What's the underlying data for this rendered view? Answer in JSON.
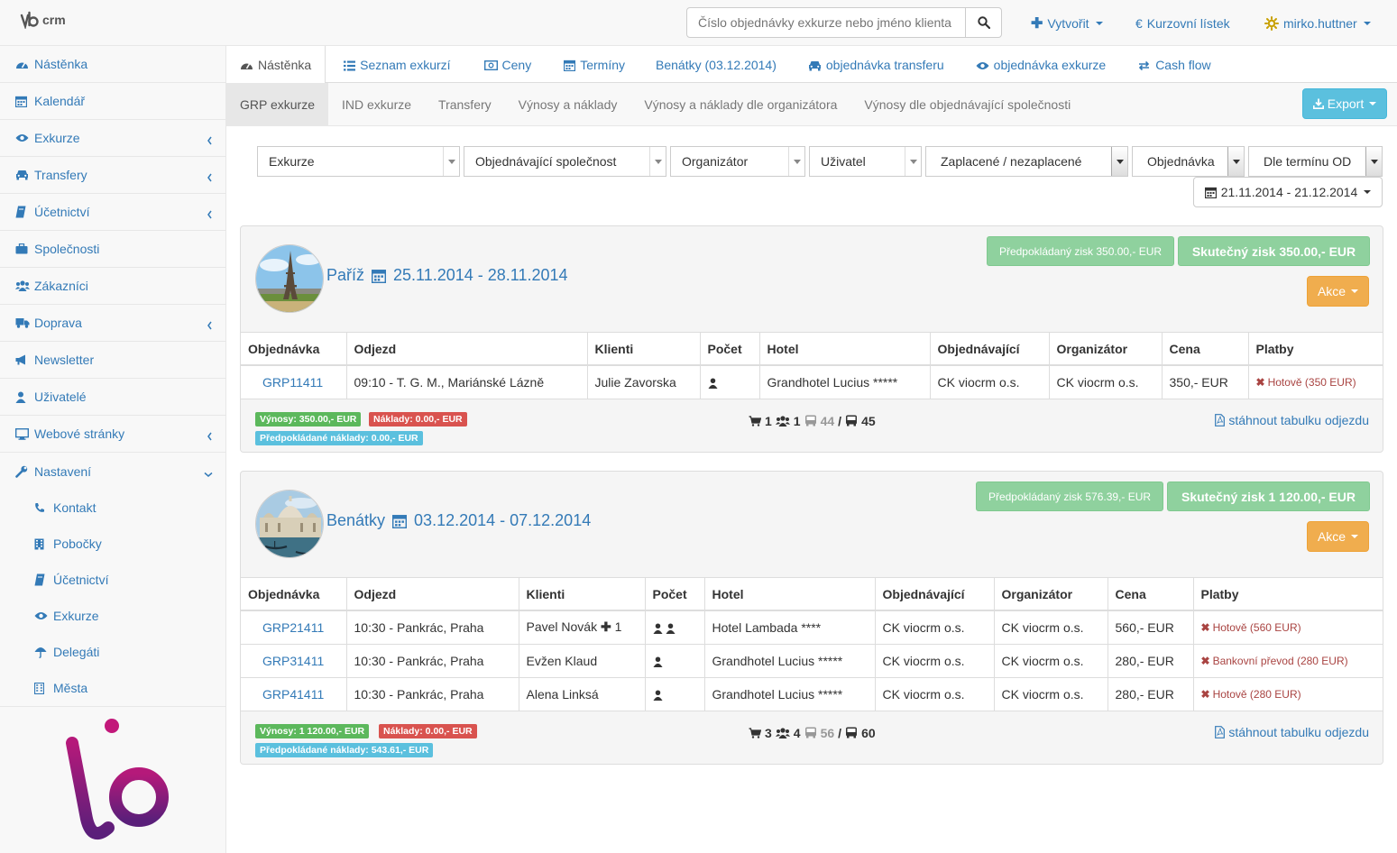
{
  "brand": {
    "name": "crm"
  },
  "search": {
    "placeholder": "Číslo objednávky exkurze nebo jméno klienta"
  },
  "topnav": {
    "create": "Vytvořit",
    "exchange": "Kurzovní lístek",
    "user": "mirko.huttner"
  },
  "sidebar": {
    "items": [
      {
        "label": "Nástěnka",
        "icon": "dashboard-icon"
      },
      {
        "label": "Kalendář",
        "icon": "calendar-icon"
      },
      {
        "label": "Exkurze",
        "icon": "eye-icon",
        "submenu": true
      },
      {
        "label": "Transfery",
        "icon": "car-icon",
        "submenu": true
      },
      {
        "label": "Účetnictví",
        "icon": "book-icon",
        "submenu": true
      },
      {
        "label": "Společnosti",
        "icon": "briefcase-icon"
      },
      {
        "label": "Zákazníci",
        "icon": "users-icon"
      },
      {
        "label": "Doprava",
        "icon": "truck-icon",
        "submenu": true
      },
      {
        "label": "Newsletter",
        "icon": "bullhorn-icon"
      },
      {
        "label": "Uživatelé",
        "icon": "user-icon"
      },
      {
        "label": "Webové stránky",
        "icon": "desktop-icon",
        "submenu": true
      },
      {
        "label": "Nastavení",
        "icon": "wrench-icon",
        "expanded": true
      }
    ],
    "subitems": [
      {
        "label": "Kontakt",
        "icon": "phone-icon"
      },
      {
        "label": "Pobočky",
        "icon": "building-icon"
      },
      {
        "label": "Účetnictví",
        "icon": "book-icon"
      },
      {
        "label": "Exkurze",
        "icon": "eye-icon"
      },
      {
        "label": "Delegáti",
        "icon": "umbrella-icon"
      },
      {
        "label": "Města",
        "icon": "building-icon"
      }
    ]
  },
  "tabs": [
    {
      "label": "Nástěnka",
      "icon": "dashboard-icon"
    },
    {
      "label": "Seznam exkurzí",
      "icon": "list-icon"
    },
    {
      "label": "Ceny",
      "icon": "money-icon"
    },
    {
      "label": "Termíny",
      "icon": "calendar-icon"
    },
    {
      "label": "Benátky (03.12.2014)",
      "icon": ""
    },
    {
      "label": "objednávka transferu",
      "icon": "car-icon"
    },
    {
      "label": "objednávka exkurze",
      "icon": "eye-icon"
    },
    {
      "label": "Cash flow",
      "icon": "exchange-icon"
    }
  ],
  "subtabs": [
    "GRP exkurze",
    "IND exkurze",
    "Transfery",
    "Výnosy a náklady",
    "Výnosy a náklady dle organizátora",
    "Výnosy dle objednávající společnosti"
  ],
  "export": {
    "label": "Export"
  },
  "filters": [
    "Exkurze",
    "Objednávající společnost",
    "Organizátor",
    "Uživatel",
    "Zaplacené / nezaplacené",
    "Objednávka",
    "Dle termínu OD"
  ],
  "daterange": "21.11.2014 - 21.12.2014",
  "headers": [
    "Objednávka",
    "Odjezd",
    "Klienti",
    "Počet",
    "Hotel",
    "Objednávající",
    "Organizátor",
    "Cena",
    "Platby"
  ],
  "akce": "Akce",
  "download": "stáhnout tabulku odjezdu",
  "trips": [
    {
      "city": "Paříž",
      "dates": "25.11.2014 - 28.11.2014",
      "pred_zisk": "Předpokládaný zisk 350.00,- EUR",
      "skut_zisk": "Skutečný zisk 350.00,- EUR",
      "rows": [
        {
          "order": "GRP11411",
          "departure": "09:10 - T. G. M., Mariánské Lázně",
          "client": "Julie Zavorska",
          "extra": "",
          "count": 1,
          "hotel": "Grandhotel Lucius *****",
          "company": "CK viocrm o.s.",
          "organizer": "CK viocrm o.s.",
          "price": "350,- EUR",
          "payment": "Hotově (350 EUR)"
        }
      ],
      "vynosy": "Výnosy: 350.00,- EUR",
      "naklady": "Náklady: 0.00,- EUR",
      "pred_naklady": "Předpokládané náklady: 0.00,- EUR",
      "stats": {
        "orders": "1",
        "persons": "1",
        "capacity": "44",
        "seats": "45"
      }
    },
    {
      "city": "Benátky",
      "dates": "03.12.2014 - 07.12.2014",
      "pred_zisk": "Předpokládaný zisk 576.39,- EUR",
      "skut_zisk": "Skutečný zisk 1 120.00,- EUR",
      "rows": [
        {
          "order": "GRP21411",
          "departure": "10:30 - Pankrác, Praha",
          "client": "Pavel Novák",
          "extra": "1",
          "count": 2,
          "hotel": "Hotel Lambada ****",
          "company": "CK viocrm o.s.",
          "organizer": "CK viocrm o.s.",
          "price": "560,- EUR",
          "payment": "Hotově (560 EUR)"
        },
        {
          "order": "GRP31411",
          "departure": "10:30 - Pankrác, Praha",
          "client": "Evžen Klaud",
          "extra": "",
          "count": 1,
          "hotel": "Grandhotel Lucius *****",
          "company": "CK viocrm o.s.",
          "organizer": "CK viocrm o.s.",
          "price": "280,- EUR",
          "payment": "Bankovní převod (280 EUR)"
        },
        {
          "order": "GRP41411",
          "departure": "10:30 - Pankrác, Praha",
          "client": "Alena Linksá",
          "extra": "",
          "count": 1,
          "hotel": "Grandhotel Lucius *****",
          "company": "CK viocrm o.s.",
          "organizer": "CK viocrm o.s.",
          "price": "280,- EUR",
          "payment": "Hotově (280 EUR)"
        }
      ],
      "vynosy": "Výnosy: 1 120.00,- EUR",
      "naklady": "Náklady: 0.00,- EUR",
      "pred_naklady": "Předpokládané náklady: 543.61,- EUR",
      "stats": {
        "orders": "3",
        "persons": "4",
        "capacity": "56",
        "seats": "60"
      }
    }
  ],
  "colors": {
    "link": "#337ab7",
    "success": "#5cb85c",
    "danger": "#d9534f",
    "info": "#5bc0de",
    "warning": "#f0ad4e",
    "brand": "#8e1a6b"
  }
}
